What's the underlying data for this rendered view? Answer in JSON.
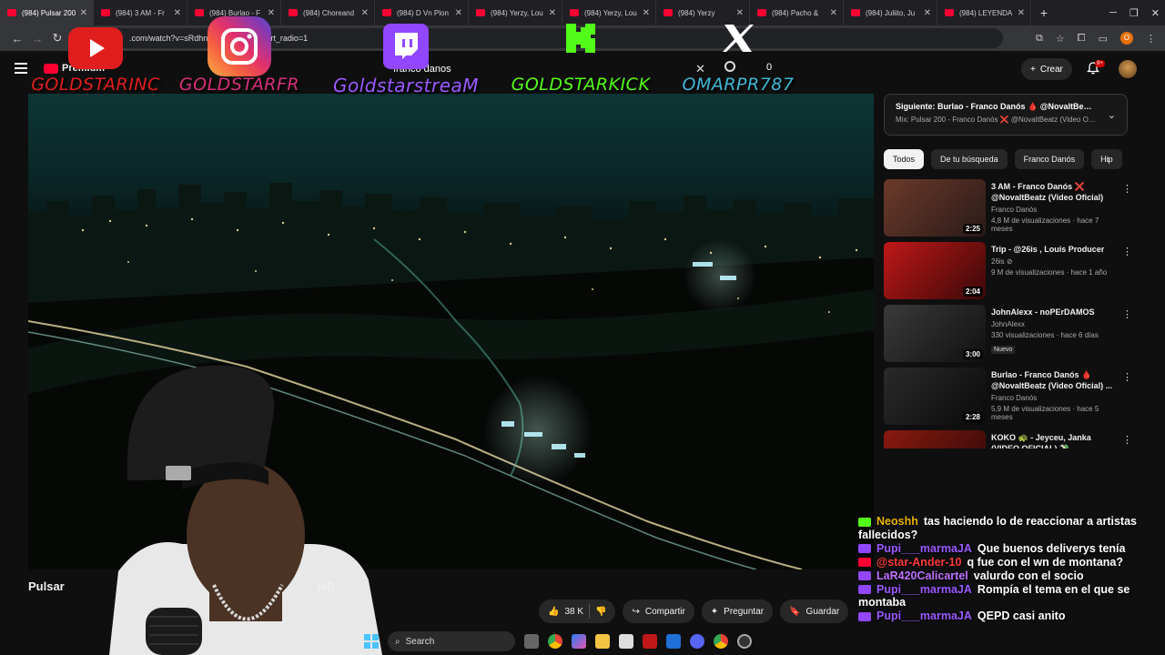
{
  "browser": {
    "tabs": [
      {
        "label": "(984) Pulsar 200",
        "active": true
      },
      {
        "label": "(984) 3 AM - Fr",
        "active": false
      },
      {
        "label": "(984) Burlao - F",
        "active": false
      },
      {
        "label": "(984) Choreand",
        "active": false
      },
      {
        "label": "(984) D Vn Plon",
        "active": false
      },
      {
        "label": "(984) Yerzy, Lou",
        "active": false
      },
      {
        "label": "(984) Yerzy, Lou",
        "active": false
      },
      {
        "label": "(984) Yerzy",
        "active": false
      },
      {
        "label": "(984) Pacho &",
        "active": false
      },
      {
        "label": "(984) Juliito, Ju",
        "active": false
      },
      {
        "label": "(984) LEYENDA",
        "active": false
      }
    ],
    "new_tab": "+",
    "url": ".com/watch?v=sRdhn                    Rdhn7jENt4&start_radio=1",
    "profile_initial": "O"
  },
  "youtube": {
    "logo_text": "Premium",
    "search_value": "franco danos",
    "counter": "0",
    "create_label": "Crear",
    "notif_badge": "9+"
  },
  "overlay": {
    "socials": [
      {
        "platform": "youtube",
        "handle": "GOLDSTARINC",
        "color": "#e01e1e"
      },
      {
        "platform": "instagram",
        "handle": "GOLDSTARFR",
        "color": "#d6307a"
      },
      {
        "platform": "twitch",
        "handle": "GoldstarstreaM",
        "color": "#9146ff"
      },
      {
        "platform": "kick",
        "handle": "GOLDSTARKICK",
        "color": "#53fc18"
      },
      {
        "platform": "x",
        "handle": "OMARPR787",
        "color": "#3fb7d6"
      }
    ]
  },
  "video": {
    "title_start": "Pulsar",
    "title_end": "ial)",
    "like_count": "38 K",
    "share_label": "Compartir",
    "ask_label": "Preguntar",
    "save_label": "Guardar"
  },
  "sidebar": {
    "next_line1": "Siguiente: Burlao - Franco Danós 🩸 @NovaltBeatz (...",
    "next_line2": "Mix: Pulsar 200 - Franco Danós ❌ @NovaltBeatz (Video Ofi...",
    "chips": [
      {
        "label": "Todos",
        "active": true
      },
      {
        "label": "De tu búsqueda",
        "active": false
      },
      {
        "label": "Franco Danós",
        "active": false
      },
      {
        "label": "Hip",
        "active": false
      }
    ],
    "recommendations": [
      {
        "title": "3 AM - Franco Danós ❌ @NovaltBeatz  (Video Oficial)",
        "channel": "Franco Danós",
        "stats": "4,8 M de visualizaciones · hace 7 meses",
        "duration": "2:25",
        "badge": ""
      },
      {
        "title": "Trip - @26is , Louis Producer",
        "channel": "26is ⊘",
        "stats": "9 M de visualizaciones · hace 1 año",
        "duration": "2:04",
        "badge": ""
      },
      {
        "title": "JohnAlexx - noPErDAMOS",
        "channel": "JohnAlexx",
        "stats": "330 visualizaciones · hace 6 días",
        "duration": "3:00",
        "badge": "Nuevo"
      },
      {
        "title": "Burlao - Franco Danós 🩸 @NovaltBeatz (Video Oficial) ...",
        "channel": "Franco Danós",
        "stats": "5,9 M de visualizaciones · hace 5 meses",
        "duration": "2:28",
        "badge": ""
      },
      {
        "title": "KOKO 🐢 - Jeyceu, Janka (VIDEO OFICIAL) 💸",
        "channel": "",
        "stats": "",
        "duration": "",
        "badge": ""
      }
    ]
  },
  "chat": [
    {
      "platform": "kick",
      "user": "Neoshh",
      "user_color": "#e8b300",
      "text": "tas haciendo lo de reaccionar a artistas fallecidos?"
    },
    {
      "platform": "twitch",
      "user": "Pupi___marmaJA",
      "user_color": "#9b59ff",
      "text": "Que buenos deliverys tenía"
    },
    {
      "platform": "youtube",
      "user": "@star-Ander-10",
      "user_color": "#ff3b3b",
      "text": "q fue con el wn de montana?"
    },
    {
      "platform": "twitch",
      "user": "LaR420Calicartel",
      "user_color": "#c070ff",
      "text": "valurdo con el socio"
    },
    {
      "platform": "twitch",
      "user": "Pupi___marmaJA",
      "user_color": "#9b59ff",
      "text": "Rompía el tema en el que se montaba"
    },
    {
      "platform": "twitch",
      "user": "Pupi___marmaJA",
      "user_color": "#9b59ff",
      "text": "QEPD casi anito"
    }
  ],
  "taskbar": {
    "search_label": "Search"
  }
}
